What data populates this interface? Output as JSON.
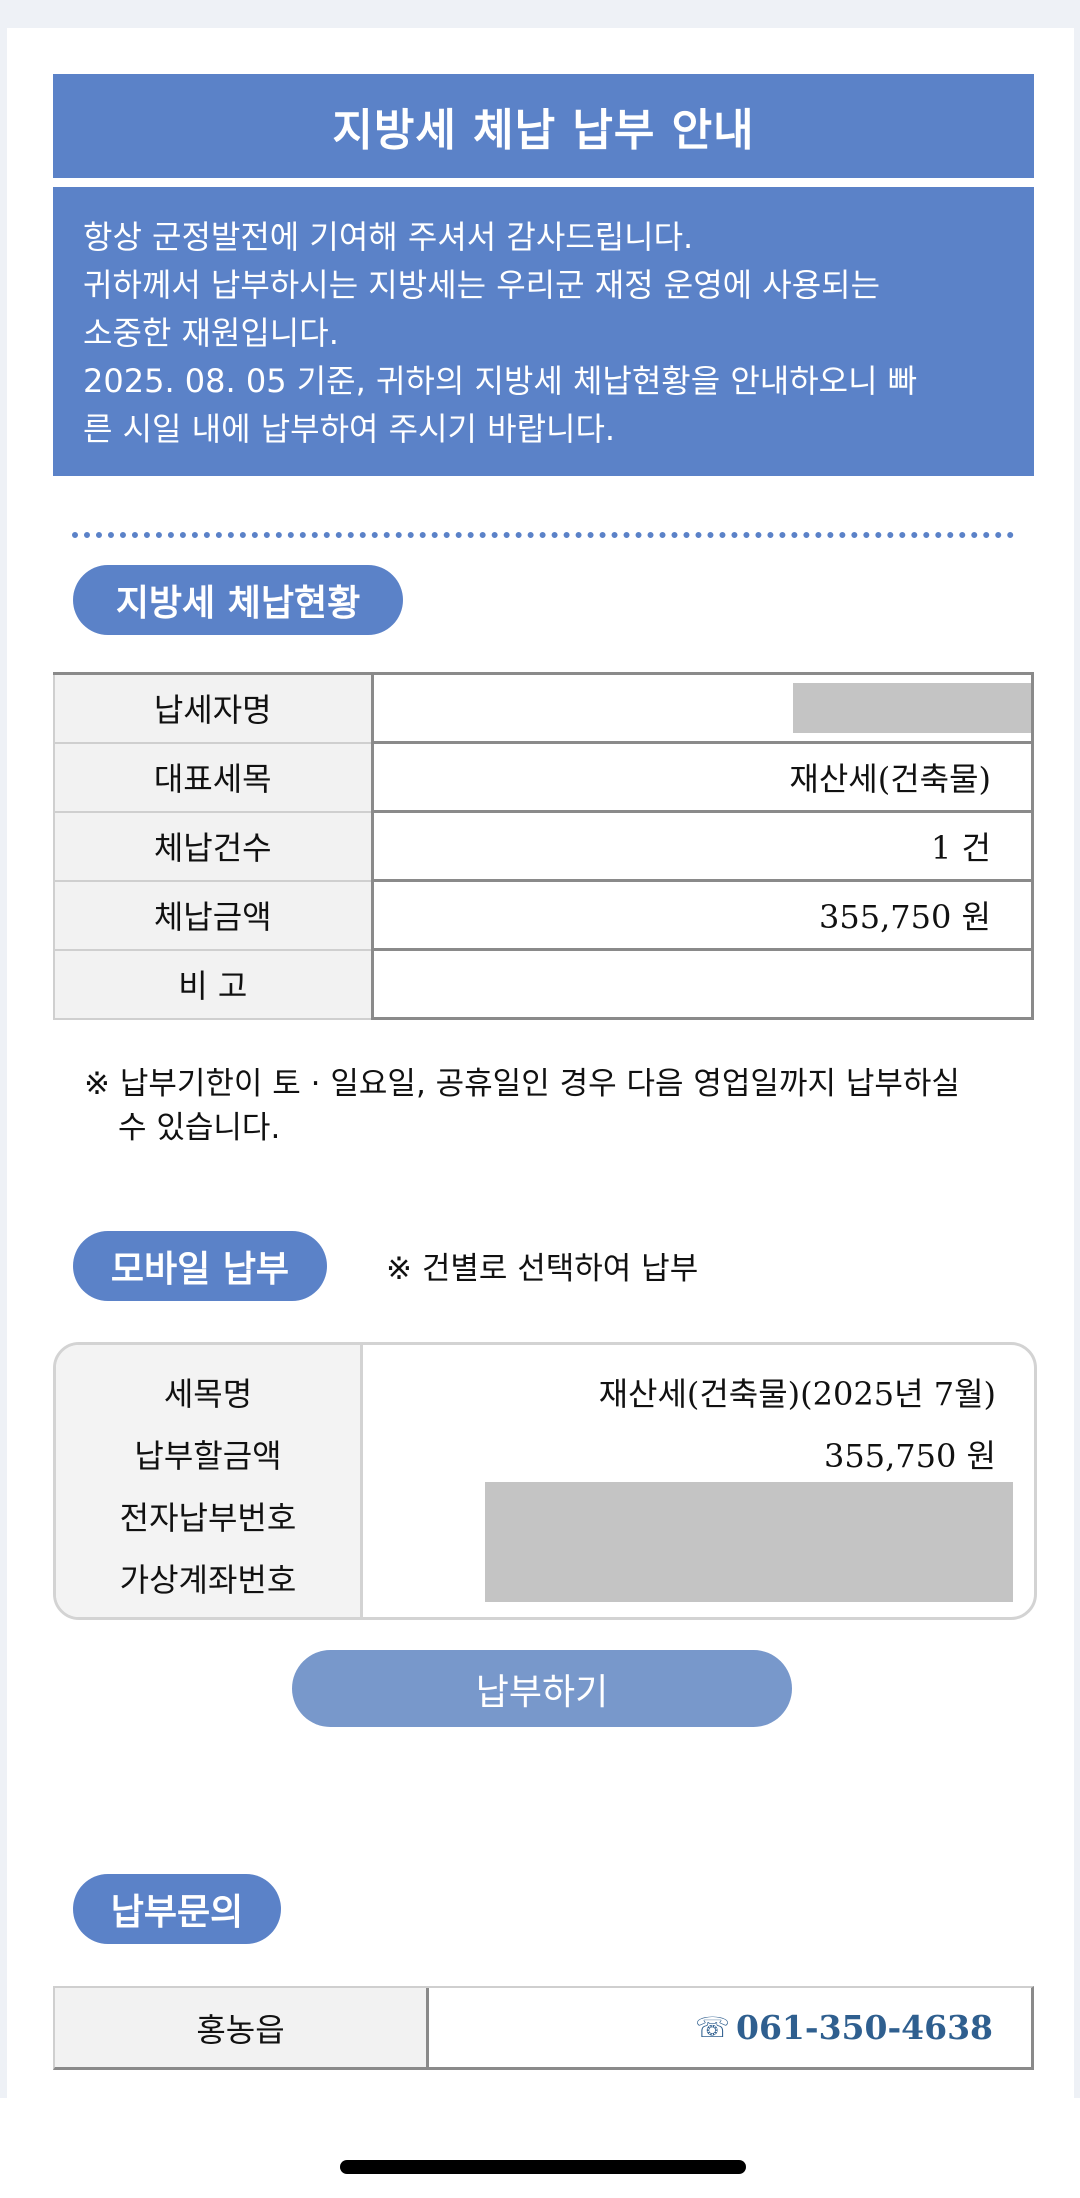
{
  "header": {
    "title": "지방세 체납 납부 안내"
  },
  "intro": {
    "lines": [
      "항상 군정발전에 기여해 주셔서 감사드립니다.",
      "귀하께서 납부하시는 지방세는 우리군 재정 운영에 사용되는",
      "소중한 재원입니다.",
      "2025. 08. 05 기준, 귀하의 지방세 체납현황을 안내하오니 빠",
      "른 시일 내에 납부하여 주시기 바랍니다."
    ]
  },
  "status_section": {
    "title": "지방세 체납현황",
    "rows": [
      {
        "label": "납세자명",
        "value": ""
      },
      {
        "label": "대표세목",
        "value": "재산세(건축물)"
      },
      {
        "label": "체납건수",
        "value": "1 건"
      },
      {
        "label": "체납금액",
        "value": "355,750 원"
      },
      {
        "label": "비 고",
        "value": ""
      }
    ]
  },
  "notice": {
    "mark": "※",
    "line1": "납부기한이 토 · 일요일, 공휴일인 경우 다음 영업일까지 납부하실",
    "line2": "수 있습니다."
  },
  "mobile_section": {
    "title": "모바일 납부",
    "note": "※ 건별로 선택하여 납부",
    "labels": [
      "세목명",
      "납부할금액",
      "전자납부번호",
      "가상계좌번호"
    ],
    "tax_name": "재산세(건축물)(2025년 7월)",
    "amount": "355,750 원",
    "button_label": "납부하기"
  },
  "contact_section": {
    "title": "납부문의",
    "office": "홍농읍",
    "phone": "061-350-4638",
    "phone_icon": "☏"
  }
}
